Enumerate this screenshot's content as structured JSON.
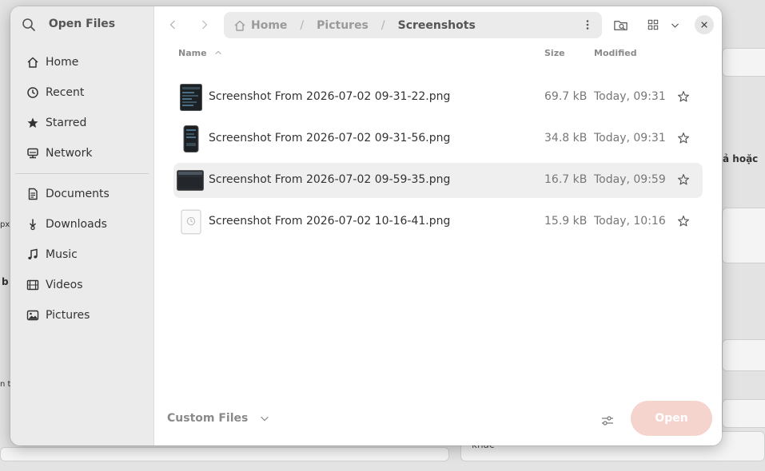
{
  "background": {
    "fragments": [
      "px",
      "b",
      "n t",
      "ả hoặc",
      "khác"
    ]
  },
  "sidebar": {
    "title": "Open Files",
    "groups": [
      [
        {
          "label": "Home",
          "icon": "home-icon"
        },
        {
          "label": "Recent",
          "icon": "recent-icon"
        },
        {
          "label": "Starred",
          "icon": "star-icon"
        },
        {
          "label": "Network",
          "icon": "network-icon"
        }
      ],
      [
        {
          "label": "Documents",
          "icon": "documents-icon"
        },
        {
          "label": "Downloads",
          "icon": "downloads-icon"
        },
        {
          "label": "Music",
          "icon": "music-icon"
        },
        {
          "label": "Videos",
          "icon": "videos-icon"
        },
        {
          "label": "Pictures",
          "icon": "pictures-icon"
        }
      ]
    ]
  },
  "toolbar": {
    "breadcrumbs": [
      "Home",
      "Pictures",
      "Screenshots"
    ]
  },
  "list": {
    "headers": {
      "name": "Name",
      "size": "Size",
      "modified": "Modified"
    },
    "files": [
      {
        "name": "Screenshot From 2026-07-02 09-31-22.png",
        "size": "69.7 kB",
        "modified": "Today, 09:31",
        "selected": false
      },
      {
        "name": "Screenshot From 2026-07-02 09-31-56.png",
        "size": "34.8 kB",
        "modified": "Today, 09:31",
        "selected": false
      },
      {
        "name": "Screenshot From 2026-07-02 09-59-35.png",
        "size": "16.7 kB",
        "modified": "Today, 09:59",
        "selected": true
      },
      {
        "name": "Screenshot From 2026-07-02 10-16-41.png",
        "size": "15.9 kB",
        "modified": "Today, 10:16",
        "selected": false
      }
    ]
  },
  "footer": {
    "filter": "Custom Files",
    "open_label": "Open"
  },
  "colors": {
    "open_button_bg": "#f4d4cc",
    "sidebar_bg": "#ebebeb",
    "selected_row_bg": "#efefef"
  }
}
